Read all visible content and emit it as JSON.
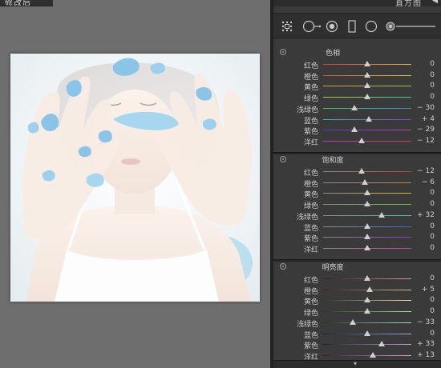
{
  "left_tab": {
    "label": "修改后"
  },
  "panel": {
    "header_title": "直方图",
    "header_arrow": "◀",
    "footer_arrow": "▾"
  },
  "tools": [
    {
      "icon": "grid-overlay-icon"
    },
    {
      "icon": "spot-removal-icon"
    },
    {
      "icon": "red-eye-icon"
    },
    {
      "icon": "graduated-filter-icon"
    },
    {
      "icon": "radial-filter-icon"
    },
    {
      "icon": "adjustment-brush-icon"
    }
  ],
  "sections": [
    {
      "title": "色相",
      "rows": [
        {
          "label": "红色",
          "value": "0",
          "slider": 0,
          "colors": [
            "#d23a3a",
            "#d9b83a"
          ]
        },
        {
          "label": "橙色",
          "value": "0",
          "slider": 0,
          "colors": [
            "#d2543a",
            "#d9c83a"
          ]
        },
        {
          "label": "黄色",
          "value": "0",
          "slider": 0,
          "colors": [
            "#d09a3a",
            "#9ac83a"
          ]
        },
        {
          "label": "绿色",
          "value": "0",
          "slider": 0,
          "colors": [
            "#b0c83a",
            "#3ac8a0"
          ]
        },
        {
          "label": "浅绿色",
          "value": "− 30",
          "slider": -30,
          "colors": [
            "#3ac86a",
            "#3a8ad0"
          ]
        },
        {
          "label": "蓝色",
          "value": "+ 4",
          "slider": 4,
          "colors": [
            "#3ab0c8",
            "#8a3ad0"
          ]
        },
        {
          "label": "紫色",
          "value": "− 29",
          "slider": -29,
          "colors": [
            "#5a3ad0",
            "#d03ab0"
          ]
        },
        {
          "label": "洋红",
          "value": "− 12",
          "slider": -12,
          "colors": [
            "#b03ad0",
            "#d03a5a"
          ]
        }
      ]
    },
    {
      "title": "饱和度",
      "rows": [
        {
          "label": "红色",
          "value": "− 12",
          "slider": -12,
          "colors": [
            "#8a8a8a",
            "#d23a3a"
          ]
        },
        {
          "label": "橙色",
          "value": "− 6",
          "slider": -6,
          "colors": [
            "#8a8a8a",
            "#d2783a"
          ]
        },
        {
          "label": "黄色",
          "value": "0",
          "slider": 0,
          "colors": [
            "#8a8a8a",
            "#d0c03a"
          ]
        },
        {
          "label": "绿色",
          "value": "0",
          "slider": 0,
          "colors": [
            "#8a8a8a",
            "#5ac83a"
          ]
        },
        {
          "label": "浅绿色",
          "value": "+ 32",
          "slider": 32,
          "colors": [
            "#8a8a8a",
            "#3ac8b0"
          ]
        },
        {
          "label": "蓝色",
          "value": "0",
          "slider": 0,
          "colors": [
            "#8a8a8a",
            "#3a6ad0"
          ]
        },
        {
          "label": "紫色",
          "value": "0",
          "slider": 0,
          "colors": [
            "#8a8a8a",
            "#8a3ad0"
          ]
        },
        {
          "label": "洋红",
          "value": "0",
          "slider": 0,
          "colors": [
            "#8a8a8a",
            "#d03aa0"
          ]
        }
      ]
    },
    {
      "title": "明亮度",
      "rows": [
        {
          "label": "红色",
          "value": "0",
          "slider": 0,
          "colors": [
            "#3a1a1a",
            "#e89a9a"
          ]
        },
        {
          "label": "橙色",
          "value": "+ 5",
          "slider": 5,
          "colors": [
            "#3a261a",
            "#e8b89a"
          ]
        },
        {
          "label": "黄色",
          "value": "0",
          "slider": 0,
          "colors": [
            "#3a361a",
            "#e8e09a"
          ]
        },
        {
          "label": "绿色",
          "value": "0",
          "slider": 0,
          "colors": [
            "#1e3a1a",
            "#a8e89a"
          ]
        },
        {
          "label": "浅绿色",
          "value": "− 33",
          "slider": -33,
          "colors": [
            "#1a3a34",
            "#9ae8d8"
          ]
        },
        {
          "label": "蓝色",
          "value": "0",
          "slider": 0,
          "colors": [
            "#1a223a",
            "#9ab0e8"
          ]
        },
        {
          "label": "紫色",
          "value": "+ 33",
          "slider": 33,
          "colors": [
            "#2a1a3a",
            "#c89ae8"
          ]
        },
        {
          "label": "洋红",
          "value": "+ 13",
          "slider": 13,
          "colors": [
            "#3a1a30",
            "#e89ad0"
          ]
        }
      ]
    }
  ]
}
